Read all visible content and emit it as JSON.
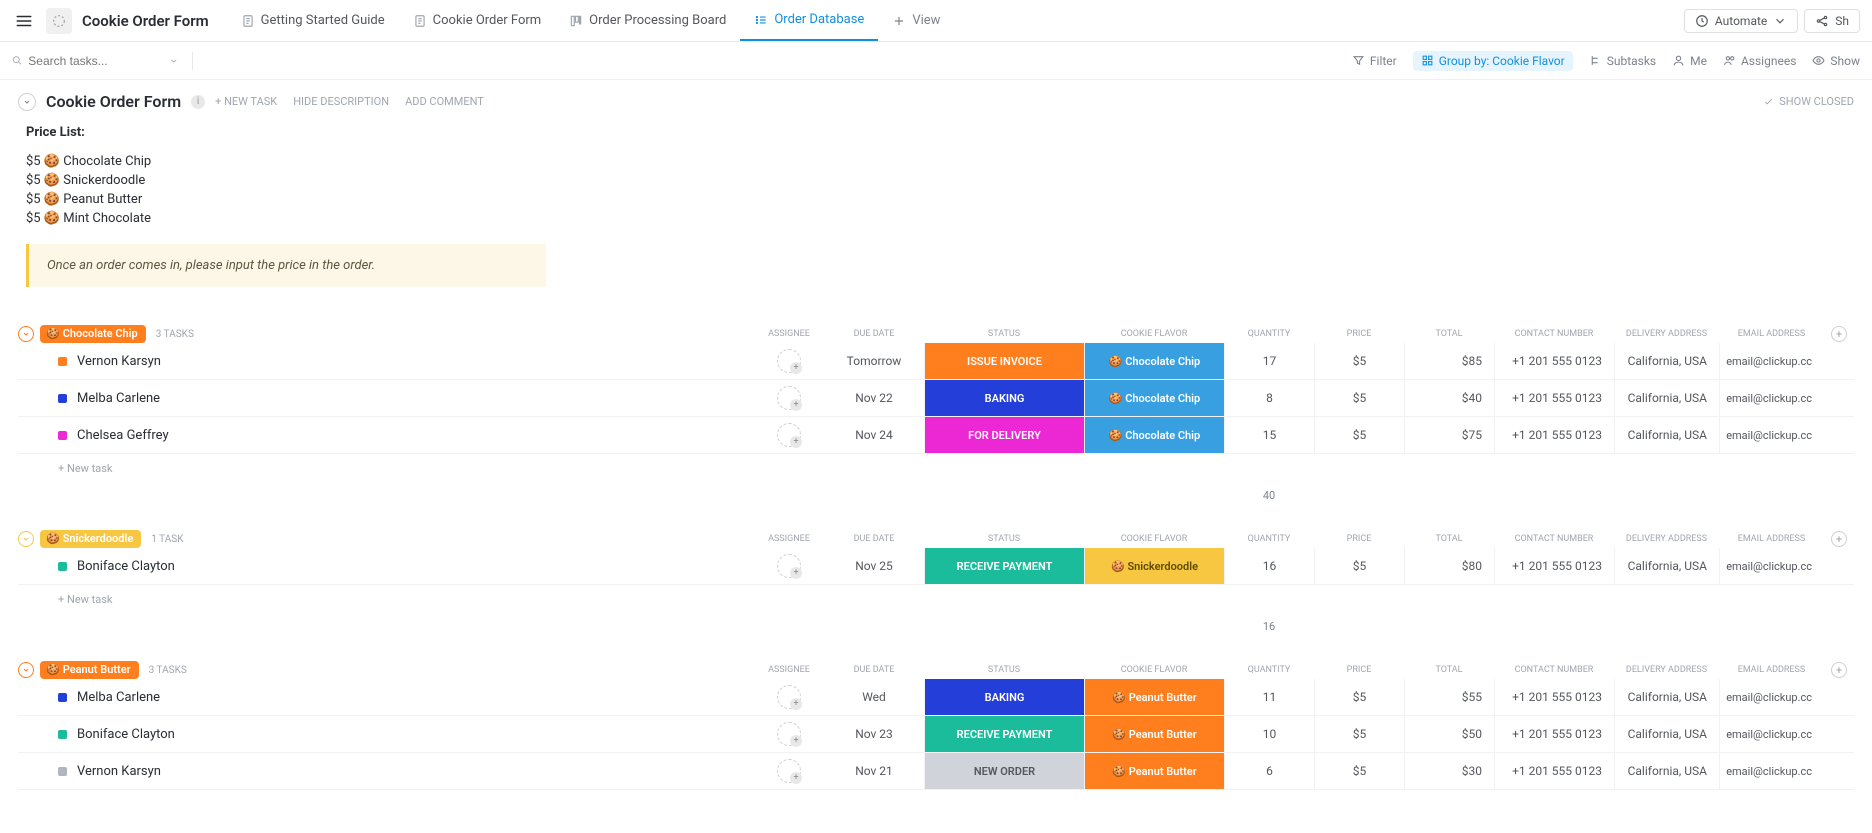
{
  "header": {
    "title": "Cookie Order Form",
    "tabs": [
      {
        "label": "Getting Started Guide",
        "icon": "doc"
      },
      {
        "label": "Cookie Order Form",
        "icon": "doc"
      },
      {
        "label": "Order Processing Board",
        "icon": "board"
      },
      {
        "label": "Order Database",
        "icon": "list",
        "active": true
      },
      {
        "label": "View",
        "icon": "plus",
        "addview": true
      }
    ],
    "automate": "Automate",
    "share": "Sh"
  },
  "toolbar": {
    "search_placeholder": "Search tasks...",
    "filter": "Filter",
    "group_by": "Group by: Cookie Flavor",
    "subtasks": "Subtasks",
    "me": "Me",
    "assignees": "Assignees",
    "show": "Show"
  },
  "list": {
    "title": "Cookie Order Form",
    "new_task": "+ NEW TASK",
    "hide_description": "HIDE DESCRIPTION",
    "add_comment": "ADD COMMENT",
    "show_closed": "SHOW CLOSED"
  },
  "description": {
    "title": "Price List:",
    "items": [
      {
        "price": "$5",
        "emoji": "🍪",
        "name": "Chocolate Chip"
      },
      {
        "price": "$5",
        "emoji": "🍪",
        "name": "Snickerdoodle"
      },
      {
        "price": "$5",
        "emoji": "🍪",
        "name": "Peanut Butter"
      },
      {
        "price": "$5",
        "emoji": "🍪",
        "name": "Mint Chocolate"
      }
    ],
    "callout": "Once an order comes in, please input the price in the order."
  },
  "columns": [
    "ASSIGNEE",
    "DUE DATE",
    "STATUS",
    "COOKIE FLAVOR",
    "QUANTITY",
    "PRICE",
    "TOTAL",
    "CONTACT NUMBER",
    "DELIVERY ADDRESS",
    "EMAIL ADDRESS"
  ],
  "new_task_label": "+ New task",
  "groups": [
    {
      "name": "Chocolate Chip",
      "emoji": "🍪",
      "color": "#ff7e1d",
      "flavor_bg": "#389fe0",
      "count": "3 TASKS",
      "tasks": [
        {
          "sq": "#ff7e1d",
          "name": "Vernon Karsyn",
          "due": "Tomorrow",
          "status": "ISSUE INVOICE",
          "status_bg": "#ff7e1d",
          "flavor": "Chocolate Chip",
          "qty": "17",
          "price": "$5",
          "total": "$85",
          "contact": "+1 201 555 0123",
          "delivery": "California, USA",
          "email": "email@clickup.cc"
        },
        {
          "sq": "#233ed9",
          "name": "Melba Carlene",
          "due": "Nov 22",
          "status": "BAKING",
          "status_bg": "#233ed9",
          "flavor": "Chocolate Chip",
          "qty": "8",
          "price": "$5",
          "total": "$40",
          "contact": "+1 201 555 0123",
          "delivery": "California, USA",
          "email": "email@clickup.cc"
        },
        {
          "sq": "#ec28d5",
          "name": "Chelsea Geffrey",
          "due": "Nov 24",
          "status": "FOR DELIVERY",
          "status_bg": "#ec28d5",
          "flavor": "Chocolate Chip",
          "qty": "15",
          "price": "$5",
          "total": "$75",
          "contact": "+1 201 555 0123",
          "delivery": "California, USA",
          "email": "email@clickup.cc"
        }
      ],
      "sum_qty": "40"
    },
    {
      "name": "Snickerdoodle",
      "emoji": "🍪",
      "color": "#f7c742",
      "flavor_bg": "#f7c742",
      "flavor_fg": "#5c4a00",
      "count": "1 TASK",
      "tasks": [
        {
          "sq": "#1bbc9c",
          "name": "Boniface Clayton",
          "due": "Nov 25",
          "status": "RECEIVE PAYMENT",
          "status_bg": "#1bbc9c",
          "flavor": "Snickerdoodle",
          "qty": "16",
          "price": "$5",
          "total": "$80",
          "contact": "+1 201 555 0123",
          "delivery": "California, USA",
          "email": "email@clickup.cc"
        }
      ],
      "sum_qty": "16"
    },
    {
      "name": "Peanut Butter",
      "emoji": "🍪",
      "color": "#ff7e1d",
      "flavor_bg": "#ff7e1d",
      "count": "3 TASKS",
      "tasks": [
        {
          "sq": "#233ed9",
          "name": "Melba Carlene",
          "due": "Wed",
          "status": "BAKING",
          "status_bg": "#233ed9",
          "flavor": "Peanut Butter",
          "qty": "11",
          "price": "$5",
          "total": "$55",
          "contact": "+1 201 555 0123",
          "delivery": "California, USA",
          "email": "email@clickup.cc"
        },
        {
          "sq": "#1bbc9c",
          "name": "Boniface Clayton",
          "due": "Nov 23",
          "status": "RECEIVE PAYMENT",
          "status_bg": "#1bbc9c",
          "flavor": "Peanut Butter",
          "qty": "10",
          "price": "$5",
          "total": "$50",
          "contact": "+1 201 555 0123",
          "delivery": "California, USA",
          "email": "email@clickup.cc"
        },
        {
          "sq": "#b0b6bf",
          "name": "Vernon Karsyn",
          "due": "Nov 21",
          "status": "NEW ORDER",
          "status_bg": "#d0d4da",
          "status_fg": "#54575d",
          "flavor": "Peanut Butter",
          "qty": "6",
          "price": "$5",
          "total": "$30",
          "contact": "+1 201 555 0123",
          "delivery": "California, USA",
          "email": "email@clickup.cc"
        }
      ]
    }
  ]
}
